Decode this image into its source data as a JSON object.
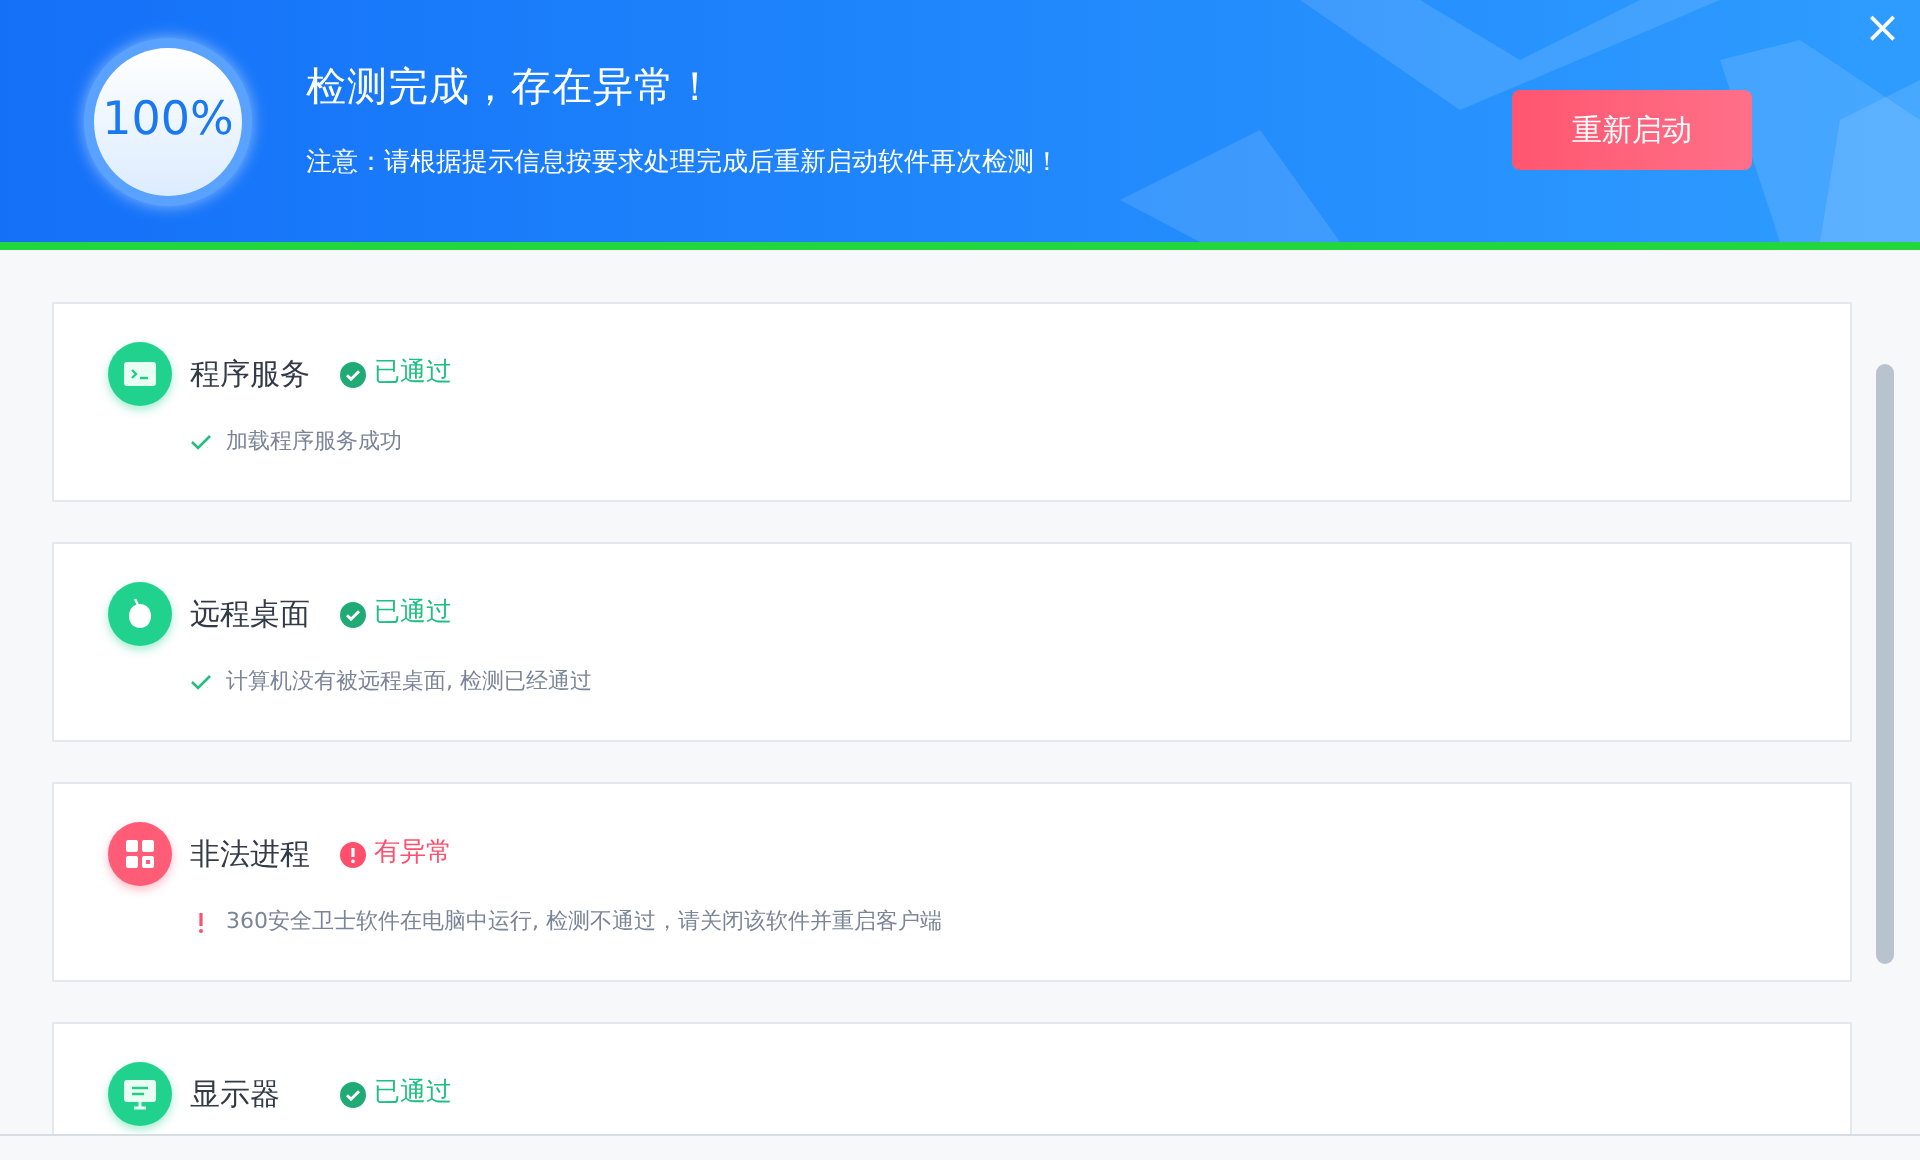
{
  "header": {
    "progress_text": "100%",
    "title": "检测完成，存在异常！",
    "notice": "注意：请根据提示信息按要求处理完成后重新启动软件再次检测！",
    "restart_button": "重新启动",
    "close_button": "×"
  },
  "checks": [
    {
      "title": "程序服务",
      "kind": "passed",
      "status": "已通过",
      "detail": "加载程序服务成功"
    },
    {
      "title": "远程桌面",
      "kind": "passed",
      "status": "已通过",
      "detail": "计算机没有被远程桌面, 检测已经通过"
    },
    {
      "title": "非法进程",
      "kind": "abnormal",
      "status": "有异常",
      "detail": "360安全卫士软件在电脑中运行, 检测不通过，请关闭该软件并重启客户端"
    },
    {
      "title": "显示器",
      "kind": "passed",
      "status": "已通过"
    }
  ]
}
